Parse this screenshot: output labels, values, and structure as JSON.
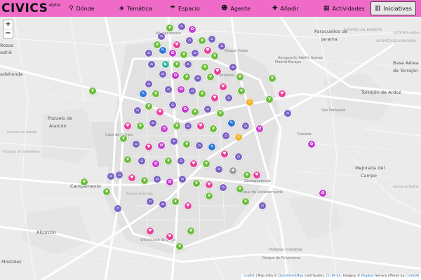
{
  "app": {
    "logo": "CIVICS",
    "logo_suffix": "alpha"
  },
  "nav": [
    {
      "label": "Dónde",
      "icon": "map-marker-icon",
      "glyph": "⚲"
    },
    {
      "label": "Temática",
      "icon": "tag-icon",
      "glyph": "◈"
    },
    {
      "label": "Espacio",
      "icon": "umbrella-icon",
      "glyph": "☂"
    },
    {
      "label": "Agente",
      "icon": "users-icon",
      "glyph": "☻"
    },
    {
      "label": "Añadir",
      "icon": "plus-icon",
      "glyph": "✚"
    },
    {
      "label": "Actividades",
      "icon": "calendar-icon",
      "glyph": "▦"
    },
    {
      "label": "Iniciativas",
      "icon": "map-icon",
      "glyph": "▥"
    }
  ],
  "zoom": {
    "in": "+",
    "out": "−"
  },
  "colors": {
    "topbar": "#f06bc8",
    "active_tab": "#e8e8e8"
  },
  "map_labels": [
    {
      "text": "Paracuellos de",
      "class": "big"
    },
    {
      "text": "Jarama",
      "class": "big"
    },
    {
      "text": "Rozas",
      "class": "big"
    },
    {
      "text": "adrid",
      "class": "big"
    },
    {
      "text": "Base Aérea",
      "class": "big"
    },
    {
      "text": "de Torrejón",
      "class": "big"
    },
    {
      "text": "Torrejón de Ardoz",
      "class": "big"
    },
    {
      "text": "adahonda",
      "class": "big"
    },
    {
      "text": "Pozuelo de",
      "class": "big"
    },
    {
      "text": "Alarcón",
      "class": "big"
    },
    {
      "text": "Mejorada del",
      "class": "big"
    },
    {
      "text": "Campo",
      "class": "big"
    },
    {
      "text": "Campamento",
      "class": "big"
    },
    {
      "text": "Alcorcón",
      "class": "big"
    },
    {
      "text": "Móstoles",
      "class": "big"
    },
    {
      "text": "Montecarmelo",
      "class": ""
    },
    {
      "text": "Hortaleza",
      "class": ""
    },
    {
      "text": "Parque Felipe",
      "class": ""
    },
    {
      "text": "Aeropuerto Adolfo Suárez",
      "class": ""
    },
    {
      "text": "Madrid-Barajas",
      "class": ""
    },
    {
      "text": "San Fernando",
      "class": ""
    },
    {
      "text": "Coslada",
      "class": ""
    },
    {
      "text": "Casa de Campo",
      "class": ""
    },
    {
      "text": "Zarzaquemada",
      "class": ""
    },
    {
      "text": "Parque de Valdebernardo",
      "class": ""
    },
    {
      "text": "Polígono Industrial",
      "class": ""
    },
    {
      "text": "Parque de Polvoranca",
      "class": ""
    },
    {
      "text": "Villaviciosa de Odón",
      "class": ""
    },
    {
      "text": "AUTOPISTA DEL NORDESTE",
      "class": "road"
    },
    {
      "text": "AUTOPISTA RADIAL 2",
      "class": "road"
    },
    {
      "text": "AUTOPISTA DE LA MUDARRA",
      "class": "road"
    },
    {
      "text": "Carretera de Boadilla",
      "class": "road"
    },
    {
      "text": "Autopista de Extremadura",
      "class": "road"
    },
    {
      "text": "Avenida de Europa",
      "class": "road"
    },
    {
      "text": "Autovía de Madrid",
      "class": "road"
    }
  ],
  "marker_categories": {
    "purple": "#7b60c4",
    "green": "#6cbd3a",
    "pink": "#ea3e9a",
    "magenta": "#c63acf",
    "blue": "#2d78d6",
    "orange": "#f0b02c",
    "teal": "#2fb4a6",
    "gray": "#999999"
  },
  "markers": [
    {
      "color": "green"
    },
    {
      "color": "purple"
    },
    {
      "color": "magenta"
    },
    {
      "color": "purple"
    },
    {
      "color": "green"
    },
    {
      "color": "pink"
    },
    {
      "color": "purple"
    },
    {
      "color": "green"
    },
    {
      "color": "purple"
    },
    {
      "color": "magenta"
    },
    {
      "color": "blue"
    },
    {
      "color": "purple"
    },
    {
      "color": "green"
    },
    {
      "color": "purple"
    },
    {
      "color": "pink"
    },
    {
      "color": "purple"
    },
    {
      "color": "green"
    },
    {
      "color": "purple"
    },
    {
      "color": "green"
    },
    {
      "color": "teal"
    },
    {
      "color": "purple"
    },
    {
      "color": "green"
    },
    {
      "color": "pink"
    },
    {
      "color": "purple"
    },
    {
      "color": "green"
    },
    {
      "color": "purple"
    },
    {
      "color": "magenta"
    },
    {
      "color": "green"
    },
    {
      "color": "purple"
    },
    {
      "color": "green"
    },
    {
      "color": "pink"
    },
    {
      "color": "purple"
    },
    {
      "color": "blue"
    },
    {
      "color": "green"
    },
    {
      "color": "purple"
    },
    {
      "color": "magenta"
    },
    {
      "color": "purple"
    },
    {
      "color": "green"
    },
    {
      "color": "pink"
    },
    {
      "color": "purple"
    },
    {
      "color": "green"
    },
    {
      "color": "orange"
    },
    {
      "color": "purple"
    },
    {
      "color": "green"
    },
    {
      "color": "pink"
    },
    {
      "color": "purple"
    },
    {
      "color": "magenta"
    },
    {
      "color": "green"
    },
    {
      "color": "purple"
    },
    {
      "color": "green"
    },
    {
      "color": "blue"
    },
    {
      "color": "purple"
    },
    {
      "color": "pink"
    },
    {
      "color": "green"
    },
    {
      "color": "purple"
    },
    {
      "color": "magenta"
    },
    {
      "color": "green"
    },
    {
      "color": "purple"
    },
    {
      "color": "pink"
    },
    {
      "color": "green"
    },
    {
      "color": "purple"
    },
    {
      "color": "orange"
    },
    {
      "color": "green"
    },
    {
      "color": "purple"
    },
    {
      "color": "pink"
    },
    {
      "color": "magenta"
    },
    {
      "color": "purple"
    },
    {
      "color": "green"
    },
    {
      "color": "purple"
    },
    {
      "color": "blue"
    },
    {
      "color": "pink"
    },
    {
      "color": "purple"
    },
    {
      "color": "green"
    },
    {
      "color": "purple"
    },
    {
      "color": "magenta"
    },
    {
      "color": "green"
    },
    {
      "color": "purple"
    },
    {
      "color": "pink"
    },
    {
      "color": "green"
    },
    {
      "color": "purple"
    },
    {
      "color": "gray"
    },
    {
      "color": "green"
    },
    {
      "color": "purple"
    },
    {
      "color": "pink"
    },
    {
      "color": "green"
    },
    {
      "color": "purple"
    },
    {
      "color": "magenta"
    },
    {
      "color": "purple"
    },
    {
      "color": "green"
    },
    {
      "color": "pink"
    },
    {
      "color": "purple"
    },
    {
      "color": "green"
    },
    {
      "color": "purple"
    },
    {
      "color": "purple"
    },
    {
      "color": "green"
    },
    {
      "color": "pink"
    }
  ],
  "attribution": {
    "leaflet": "Leaflet",
    "map_data": " | Map data © ",
    "osm": "OpenStreetMap",
    "contrib": " contributors, ",
    "license": "CC-BY-SA",
    "imagery": ", Imagery © ",
    "mapbox": "Mapbox",
    "service": " Service offered by ",
    "carto": "CartoDB"
  }
}
